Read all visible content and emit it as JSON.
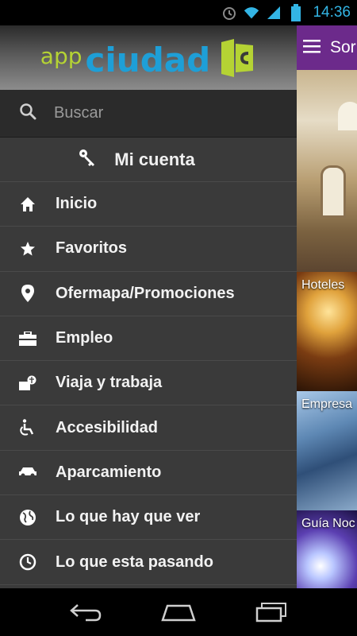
{
  "status_bar": {
    "time": "14:36",
    "icons": [
      "alarm-icon",
      "wifi-icon",
      "signal-icon",
      "battery-icon"
    ],
    "color": "#33b5e5"
  },
  "drawer": {
    "logo": {
      "app": "app",
      "ciudad": "ciudad"
    },
    "search_placeholder": "Buscar",
    "account_label": "Mi cuenta",
    "menu": [
      {
        "label": "Inicio",
        "icon": "home-icon"
      },
      {
        "label": "Favoritos",
        "icon": "star-icon"
      },
      {
        "label": "Ofermapa/Promociones",
        "icon": "map-pin-icon"
      },
      {
        "label": "Empleo",
        "icon": "briefcase-icon"
      },
      {
        "label": "Viaja y trabaja",
        "icon": "travel-icon"
      },
      {
        "label": "Accesibilidad",
        "icon": "wheelchair-icon"
      },
      {
        "label": "Aparcamiento",
        "icon": "car-icon"
      },
      {
        "label": "Lo que hay que ver",
        "icon": "globe-icon"
      },
      {
        "label": "Lo que esta pasando",
        "icon": "clock-icon"
      }
    ]
  },
  "content": {
    "title": "Sor",
    "tiles": [
      "",
      "Hoteles",
      "Empresa",
      "Guía Noc"
    ],
    "accent_color": "#6c2a8b"
  },
  "nav_bar": {
    "buttons": [
      "back-icon",
      "home-icon",
      "recent-apps-icon"
    ]
  }
}
